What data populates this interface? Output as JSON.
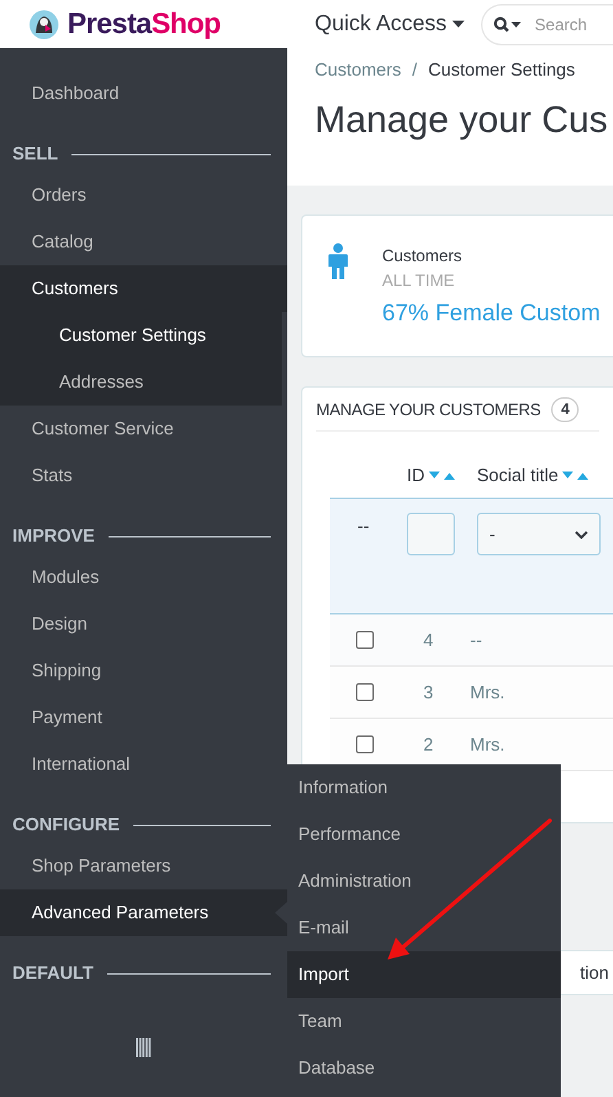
{
  "header": {
    "logo": {
      "part_1": "Presta",
      "part_2": "Shop"
    },
    "quick_access": "Quick Access",
    "search": {
      "placeholder": "Search"
    }
  },
  "breadcrumb": {
    "items": [
      "Customers",
      "Customer Settings"
    ],
    "separator": "/"
  },
  "page_title": "Manage your Cus",
  "sidebar": {
    "items": [
      {
        "kind": "link",
        "label": "Dashboard",
        "selected": false
      },
      {
        "kind": "section",
        "label": "SELL"
      },
      {
        "kind": "link",
        "label": "Orders",
        "selected": false
      },
      {
        "kind": "link",
        "label": "Catalog",
        "selected": false
      },
      {
        "kind": "link",
        "label": "Customers",
        "selected": true,
        "children": [
          {
            "label": "Customer Settings",
            "selected": true
          },
          {
            "label": "Addresses",
            "selected": false
          }
        ]
      },
      {
        "kind": "link",
        "label": "Customer Service",
        "selected": false
      },
      {
        "kind": "link",
        "label": "Stats",
        "selected": false
      },
      {
        "kind": "section",
        "label": "IMPROVE"
      },
      {
        "kind": "link",
        "label": "Modules",
        "selected": false
      },
      {
        "kind": "link",
        "label": "Design",
        "selected": false
      },
      {
        "kind": "link",
        "label": "Shipping",
        "selected": false
      },
      {
        "kind": "link",
        "label": "Payment",
        "selected": false
      },
      {
        "kind": "link",
        "label": "International",
        "selected": false
      },
      {
        "kind": "section",
        "label": "CONFIGURE"
      },
      {
        "kind": "link",
        "label": "Shop Parameters",
        "selected": false
      },
      {
        "kind": "link",
        "label": "Advanced Parameters",
        "selected": true
      },
      {
        "kind": "section",
        "label": "DEFAULT"
      }
    ]
  },
  "flyout_menu": {
    "items": [
      {
        "label": "Information",
        "selected": false
      },
      {
        "label": "Performance",
        "selected": false
      },
      {
        "label": "Administration",
        "selected": false
      },
      {
        "label": "E-mail",
        "selected": false
      },
      {
        "label": "Import",
        "selected": true
      },
      {
        "label": "Team",
        "selected": false
      },
      {
        "label": "Database",
        "selected": false
      }
    ]
  },
  "kpi": {
    "title": "Customers",
    "period": "ALL TIME",
    "value": "67% Female Custom"
  },
  "panel": {
    "title": "MANAGE YOUR CUSTOMERS",
    "count": "4",
    "columns": [
      "ID",
      "Social title"
    ],
    "filters": {
      "bulk": "--",
      "social_title": "-"
    },
    "rows": [
      {
        "checked": false,
        "id": "4",
        "social_title": "--"
      },
      {
        "checked": false,
        "id": "3",
        "social_title": "Mrs."
      },
      {
        "checked": false,
        "id": "2",
        "social_title": "Mrs."
      }
    ]
  },
  "bottom_button": "tion"
}
